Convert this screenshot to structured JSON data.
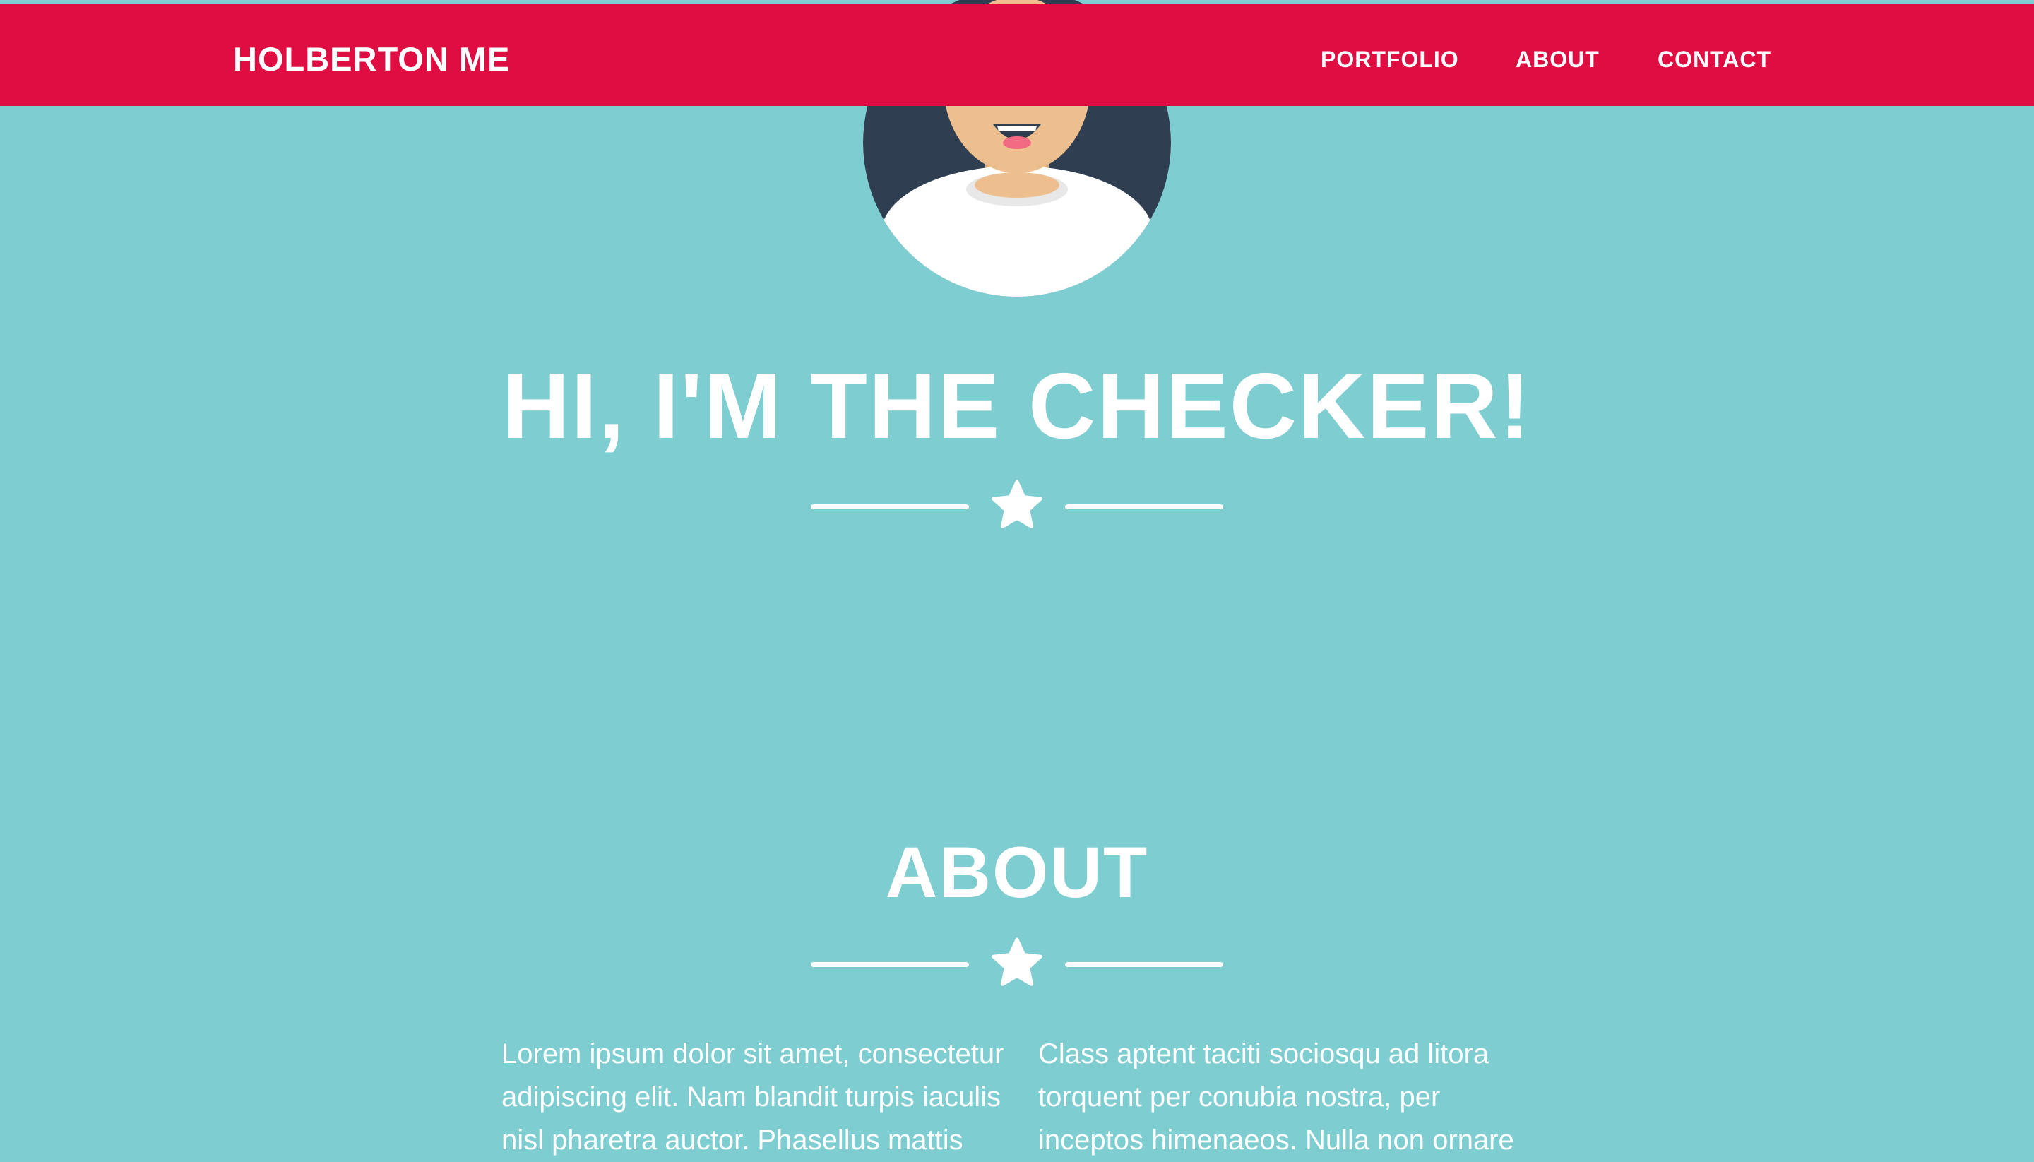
{
  "navbar": {
    "brand": "HOLBERTON ME",
    "links": [
      {
        "label": "PORTFOLIO"
      },
      {
        "label": "ABOUT"
      },
      {
        "label": "CONTACT"
      }
    ]
  },
  "hero": {
    "title": "HI, I'M THE CHECKER!",
    "divider_icon": "star-icon"
  },
  "about": {
    "title": "ABOUT",
    "divider_icon": "star-icon",
    "column1": "Lorem ipsum dolor sit amet, consectetur adipiscing elit. Nam blandit turpis iaculis nisl pharetra auctor. Phasellus mattis",
    "column2": "Class aptent taciti sociosqu ad litora torquent per conubia nostra, per inceptos himenaeos. Nulla non ornare"
  },
  "colors": {
    "navbar": "#e00d43",
    "background": "#7ecdd1",
    "text": "#ffffff",
    "avatar_circle": "#2f3e50",
    "skin": "#eebf8e",
    "shirt": "#ffffff"
  }
}
